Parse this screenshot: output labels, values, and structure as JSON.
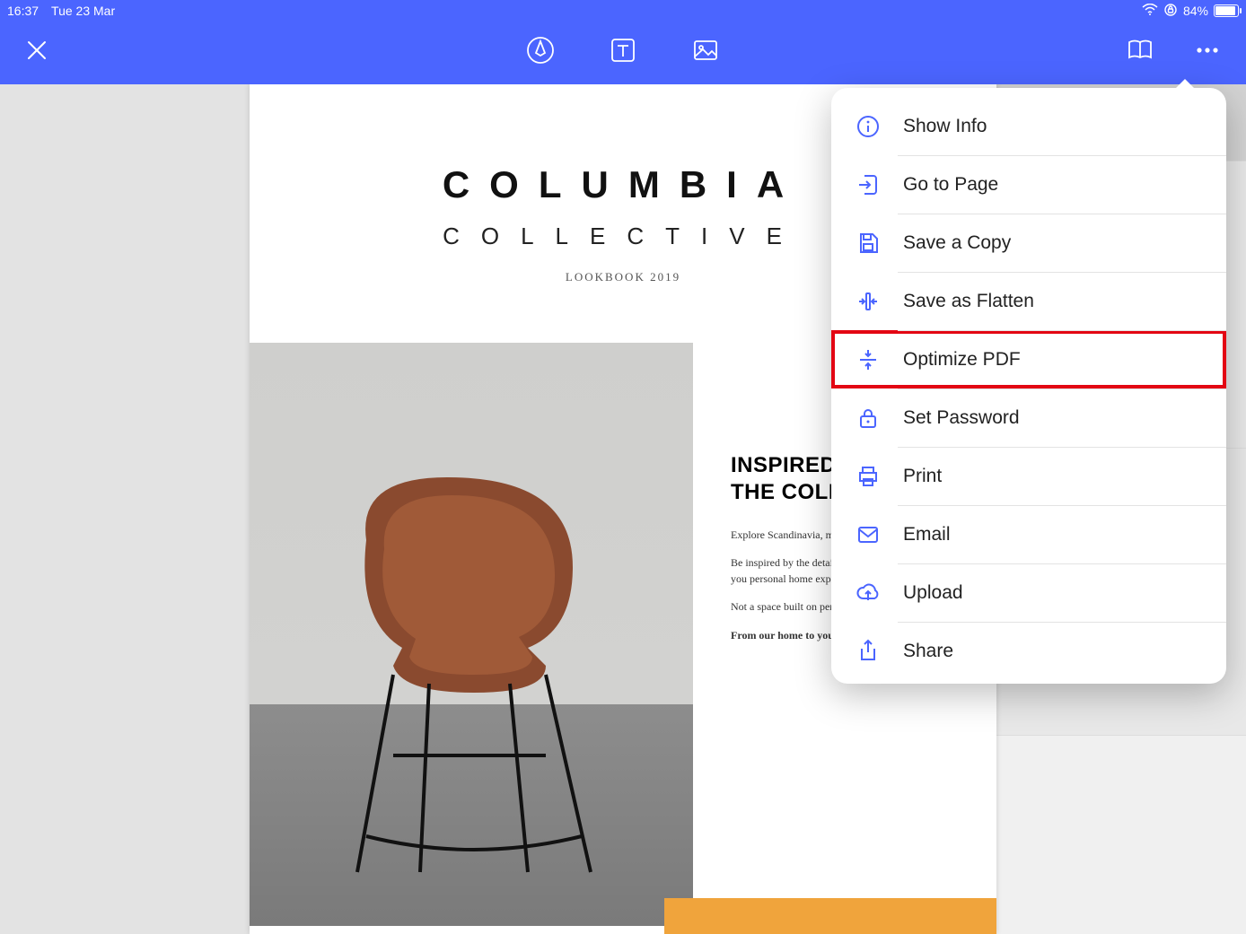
{
  "status_bar": {
    "time": "16:37",
    "date": "Tue 23 Mar",
    "battery_pct": "84%"
  },
  "toolbar": {
    "close_icon": "close",
    "pen_icon": "pen",
    "text_icon": "text",
    "image_icon": "image",
    "book_icon": "book",
    "more_icon": "more"
  },
  "document": {
    "title": "COLUMBIA",
    "subtitle": "COLLECTIVE",
    "tagline": "LOOKBOOK 2019",
    "heading_line1": "INSPIRED B",
    "heading_line2": "THE COLLE",
    "p1": "Explore Scandinavia, meet loc and renowned designers.",
    "p2": "Be inspired by the details of c design and passion to find you personal home expression.",
    "p3": "Not a space built on perfectio home made for living.",
    "p4": "From our home to yours."
  },
  "menu": {
    "items": [
      {
        "id": "info",
        "label": "Show Info",
        "icon": "info"
      },
      {
        "id": "goto",
        "label": "Go to Page",
        "icon": "goto"
      },
      {
        "id": "savecopy",
        "label": "Save a Copy",
        "icon": "save"
      },
      {
        "id": "flatten",
        "label": "Save as Flatten",
        "icon": "flatten"
      },
      {
        "id": "optimize",
        "label": "Optimize PDF",
        "icon": "optimize",
        "highlighted": true
      },
      {
        "id": "password",
        "label": "Set Password",
        "icon": "lock"
      },
      {
        "id": "print",
        "label": "Print",
        "icon": "print"
      },
      {
        "id": "email",
        "label": "Email",
        "icon": "mail"
      },
      {
        "id": "upload",
        "label": "Upload",
        "icon": "cloud"
      },
      {
        "id": "share",
        "label": "Share",
        "icon": "share"
      }
    ]
  }
}
